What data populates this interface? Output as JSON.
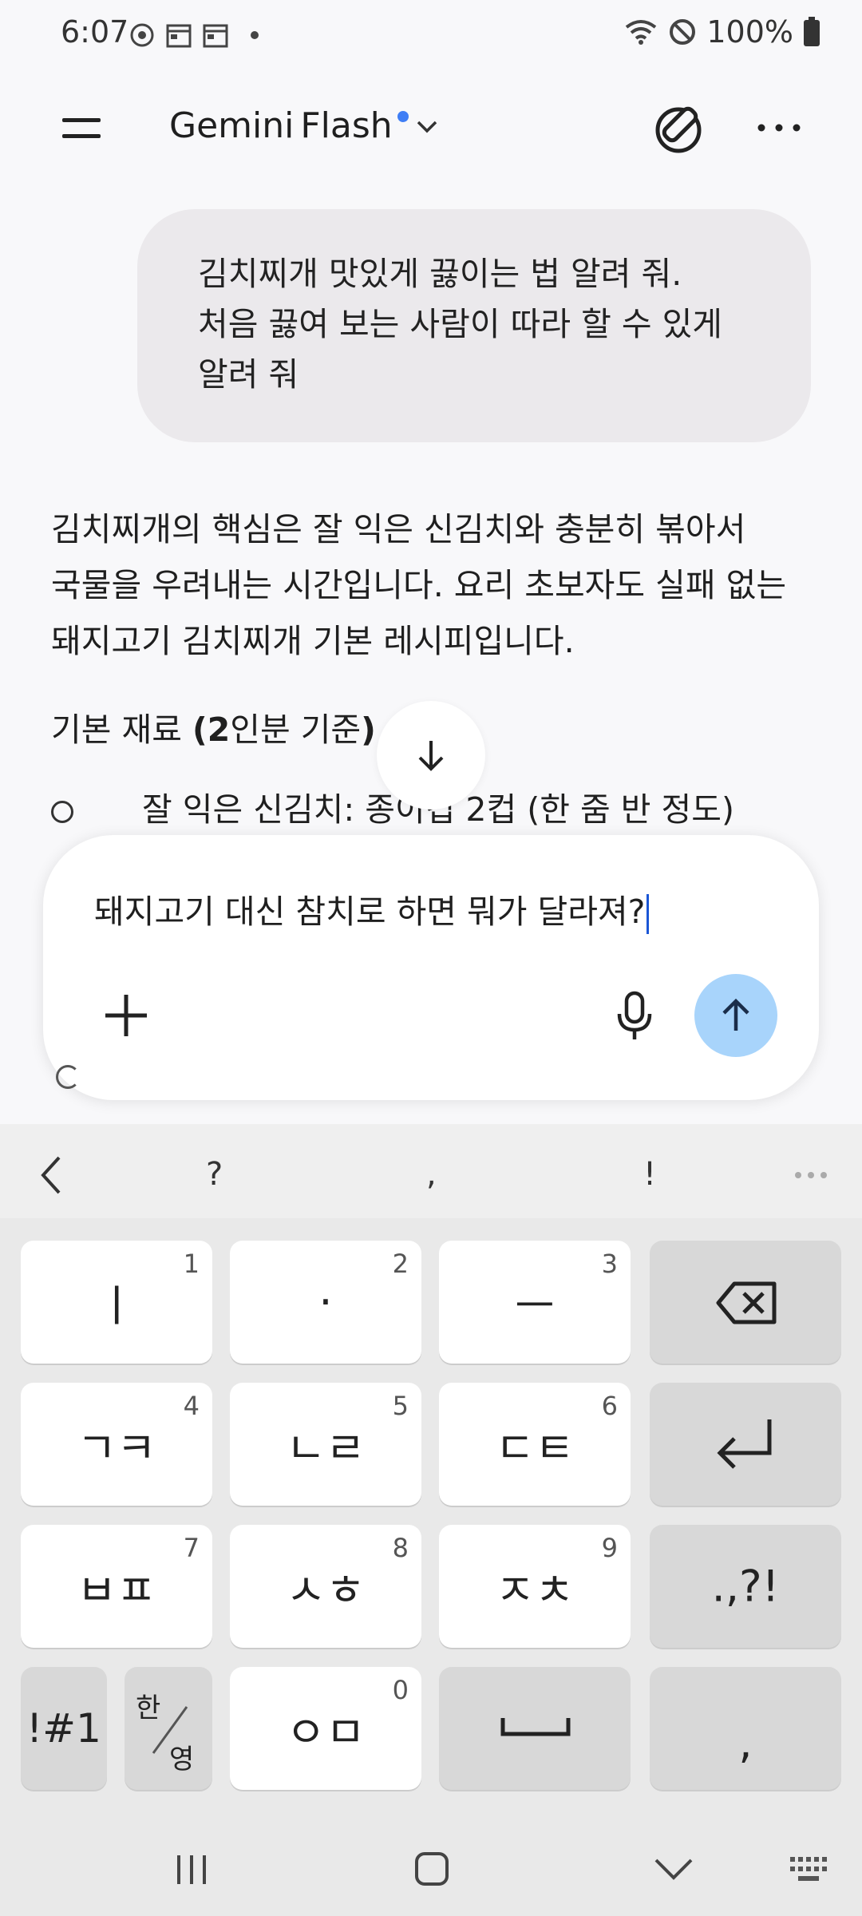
{
  "status_bar": {
    "time": "6:07",
    "battery": "100%"
  },
  "header": {
    "app_name": "Gemini",
    "model": "Flash"
  },
  "chat": {
    "user_message": [
      "김치찌개 맛있게 끓이는 법 알려 줘.",
      "처음 끓여 보는 사람이 따라 할 수 있게",
      "알려 줘"
    ],
    "response_paragraph": [
      "김치찌개의 핵심은 잘 익은 신김치와 충분히 볶아서",
      "국물을 우려내는 시간입니다. 요리 초보자도 실패 없는",
      "돼지고기 김치찌개 기본 레시피입니다."
    ],
    "section_title_bold": "기본 재료 (2",
    "section_title_rest": "인분 기준)",
    "section_title_end": ")",
    "bullet_1": "잘 익은 신김치: 종이컵 2컵 (한 줌 반 정도)"
  },
  "input": {
    "value": "돼지고기 대신 참치로 하면 뭐가 달라져?"
  },
  "keyboard": {
    "suggestions": [
      "?",
      ",",
      "!"
    ],
    "rows": [
      [
        {
          "label": "ㅣ",
          "num": "1"
        },
        {
          "label": "·",
          "num": "2"
        },
        {
          "label": "ㅡ",
          "num": "3"
        }
      ],
      [
        {
          "label": "ㄱㅋ",
          "num": "4"
        },
        {
          "label": "ㄴㄹ",
          "num": "5"
        },
        {
          "label": "ㄷㅌ",
          "num": "6"
        }
      ],
      [
        {
          "label": "ㅂㅍ",
          "num": "7"
        },
        {
          "label": "ㅅㅎ",
          "num": "8"
        },
        {
          "label": "ㅈㅊ",
          "num": "9"
        }
      ]
    ],
    "punct_key": ".,?!",
    "symbols_key": "!#1",
    "lang_key_top": "한",
    "lang_key_bottom": "영",
    "bottom_key": {
      "label": "ㅇㅁ",
      "num": "0"
    },
    "comma_key": ","
  },
  "colors": {
    "accent_dot": "#3f7ef5",
    "send_button": "#a8d4fb",
    "caret": "#1a56d6"
  }
}
